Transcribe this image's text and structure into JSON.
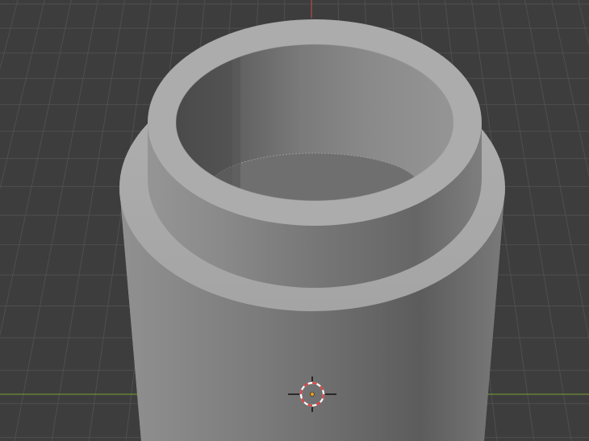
{
  "viewport": {
    "background_color": "#3d3d3d",
    "grid_line_color": "#4f4f4f",
    "x_axis_color": "#7a9a3a",
    "y_axis_color": "#b84a4a",
    "mesh_base_color": "#8a8a8a",
    "mesh_light_color": "#a9a9a9",
    "mesh_dark_color": "#454545",
    "cursor_colors": [
      "#e04040",
      "#ffffff",
      "#e8a020"
    ]
  },
  "object": {
    "icon": "hollow-cylinder-mesh"
  },
  "cursor": {
    "icon": "3d-cursor-icon"
  }
}
